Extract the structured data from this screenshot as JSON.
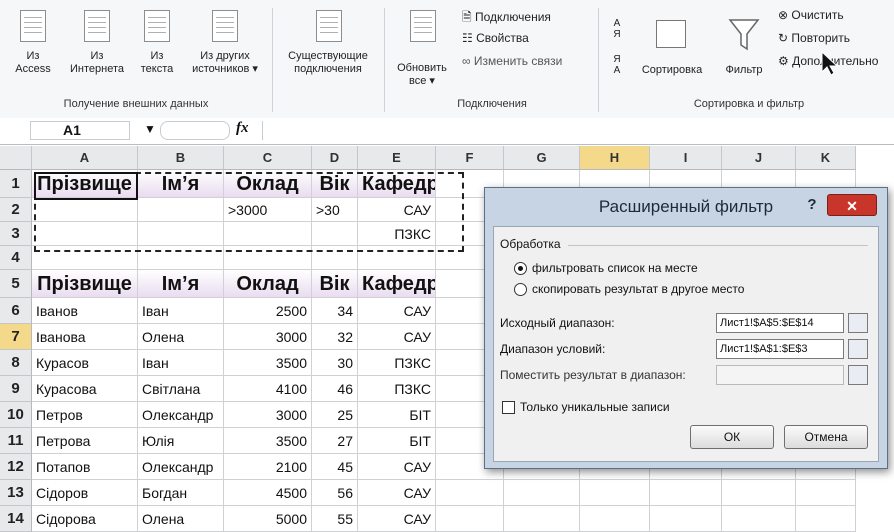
{
  "ribbon": {
    "buttons": [
      {
        "id": "access",
        "line1": "Из",
        "line2": "Access"
      },
      {
        "id": "web",
        "line1": "Из",
        "line2": "Интернета"
      },
      {
        "id": "text",
        "line1": "Из",
        "line2": "текста"
      },
      {
        "id": "other",
        "line1": "Из других",
        "line2": "источников ▾"
      },
      {
        "id": "existing",
        "line1": "Существующие",
        "line2": "подключения"
      },
      {
        "id": "refresh",
        "line1": "Обновить",
        "line2": "все ▾"
      }
    ],
    "group_external": "Получение внешних данных",
    "conn_cmds": [
      "Подключения",
      "Свойства",
      "Изменить связи"
    ],
    "group_connections": "Подключения",
    "sort_label": "Сортировка",
    "filter_label": "Фильтр",
    "filter_cmds": [
      "Очистить",
      "Повторить",
      "Дополнительно"
    ],
    "group_sort_filter": "Сортировка и фильтр",
    "sort_az_top": "А",
    "sort_az_bot": "Я",
    "sort_za_top": "Я",
    "sort_za_bot": "А"
  },
  "formula_bar": {
    "name_box": "A1",
    "fx": "fx",
    "value": ""
  },
  "columns": [
    "A",
    "B",
    "C",
    "D",
    "E",
    "F",
    "G",
    "H",
    "I",
    "J",
    "K"
  ],
  "selected_column": "H",
  "rows": [
    "1",
    "2",
    "3",
    "4",
    "5",
    "6",
    "7",
    "8",
    "9",
    "10",
    "11",
    "12",
    "13",
    "14"
  ],
  "selected_row": "7",
  "sheet": {
    "criteria_header": [
      "Прізвище",
      "Ім’я",
      "Оклад",
      "Вік",
      "Кафедра"
    ],
    "criteria_row2": [
      "",
      "",
      ">3000",
      ">30",
      "САУ"
    ],
    "criteria_row3": [
      "",
      "",
      "",
      "",
      "ПЗКС"
    ],
    "table_header": [
      "Прізвище",
      "Ім’я",
      "Оклад",
      "Вік",
      "Кафедра"
    ],
    "data": [
      [
        "Іванов",
        "Іван",
        "2500",
        "34",
        "САУ"
      ],
      [
        "Іванова",
        "Олена",
        "3000",
        "32",
        "САУ"
      ],
      [
        "Курасов",
        "Іван",
        "3500",
        "30",
        "ПЗКС"
      ],
      [
        "Курасова",
        "Світлана",
        "4100",
        "46",
        "ПЗКС"
      ],
      [
        "Петров",
        "Олександр",
        "3000",
        "25",
        "БІТ"
      ],
      [
        "Петрова",
        "Юлія",
        "3500",
        "27",
        "БІТ"
      ],
      [
        "Потапов",
        "Олександр",
        "2100",
        "45",
        "САУ"
      ],
      [
        "Сідоров",
        "Богдан",
        "4500",
        "56",
        "САУ"
      ],
      [
        "Сідорова",
        "Олена",
        "5000",
        "55",
        "САУ"
      ]
    ]
  },
  "dialog": {
    "title": "Расширенный фильтр",
    "help": "?",
    "close": "✕",
    "group_label": "Обработка",
    "radio1": "фильтровать список на месте",
    "radio2": "скопировать результат в другое место",
    "source_label": "Исходный диапазон:",
    "source_value": "Лист1!$A$5:$E$14",
    "criteria_label": "Диапазон условий:",
    "criteria_value": "Лист1!$A$1:$E$3",
    "dest_label": "Поместить результат в диапазон:",
    "dest_value": "",
    "unique_label": "Только уникальные записи",
    "ok": "ОК",
    "cancel": "Отмена"
  },
  "colors": {
    "accent": "#f5d98b",
    "dialog_frame": "#c7d4e4",
    "close_red": "#c8362b"
  }
}
